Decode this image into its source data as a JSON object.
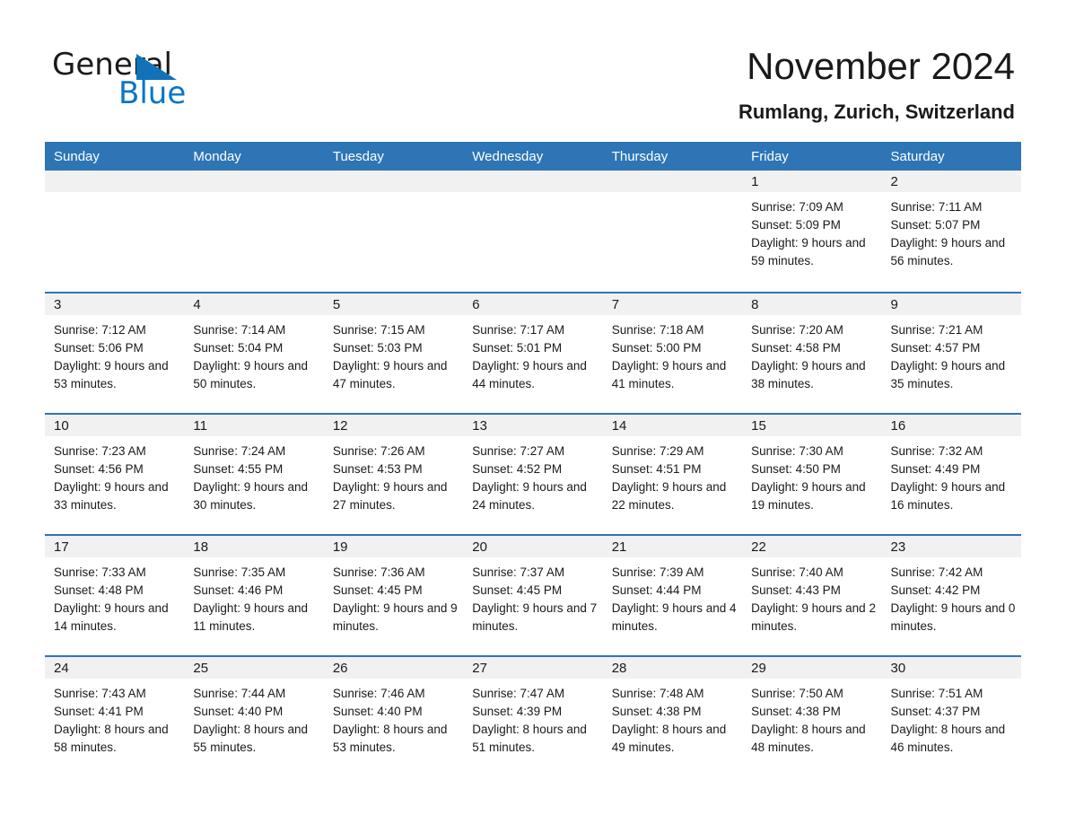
{
  "brand": {
    "name_part1": "General",
    "name_part2": "Blue",
    "triangle_color": "#1272b8",
    "blue_color": "#0a76c4"
  },
  "header": {
    "title": "November 2024",
    "location": "Rumlang, Zurich, Switzerland"
  },
  "theme": {
    "header_blue": "#2e75b6",
    "row_divider_blue": "#2e75b6",
    "daynum_band": "#f1f1f1",
    "text": "#1a1a1a",
    "page_background": "#ffffff"
  },
  "weekday_headers": [
    "Sunday",
    "Monday",
    "Tuesday",
    "Wednesday",
    "Thursday",
    "Friday",
    "Saturday"
  ],
  "labels": {
    "sunrise_prefix": "Sunrise:",
    "sunset_prefix": "Sunset:",
    "daylight_prefix": "Daylight:"
  },
  "weeks": [
    [
      {
        "day": "",
        "empty": true
      },
      {
        "day": "",
        "empty": true
      },
      {
        "day": "",
        "empty": true
      },
      {
        "day": "",
        "empty": true
      },
      {
        "day": "",
        "empty": true
      },
      {
        "day": "1",
        "sunrise": "Sunrise: 7:09 AM",
        "sunset": "Sunset: 5:09 PM",
        "daylight": "Daylight: 9 hours and 59 minutes."
      },
      {
        "day": "2",
        "sunrise": "Sunrise: 7:11 AM",
        "sunset": "Sunset: 5:07 PM",
        "daylight": "Daylight: 9 hours and 56 minutes."
      }
    ],
    [
      {
        "day": "3",
        "sunrise": "Sunrise: 7:12 AM",
        "sunset": "Sunset: 5:06 PM",
        "daylight": "Daylight: 9 hours and 53 minutes."
      },
      {
        "day": "4",
        "sunrise": "Sunrise: 7:14 AM",
        "sunset": "Sunset: 5:04 PM",
        "daylight": "Daylight: 9 hours and 50 minutes."
      },
      {
        "day": "5",
        "sunrise": "Sunrise: 7:15 AM",
        "sunset": "Sunset: 5:03 PM",
        "daylight": "Daylight: 9 hours and 47 minutes."
      },
      {
        "day": "6",
        "sunrise": "Sunrise: 7:17 AM",
        "sunset": "Sunset: 5:01 PM",
        "daylight": "Daylight: 9 hours and 44 minutes."
      },
      {
        "day": "7",
        "sunrise": "Sunrise: 7:18 AM",
        "sunset": "Sunset: 5:00 PM",
        "daylight": "Daylight: 9 hours and 41 minutes."
      },
      {
        "day": "8",
        "sunrise": "Sunrise: 7:20 AM",
        "sunset": "Sunset: 4:58 PM",
        "daylight": "Daylight: 9 hours and 38 minutes."
      },
      {
        "day": "9",
        "sunrise": "Sunrise: 7:21 AM",
        "sunset": "Sunset: 4:57 PM",
        "daylight": "Daylight: 9 hours and 35 minutes."
      }
    ],
    [
      {
        "day": "10",
        "sunrise": "Sunrise: 7:23 AM",
        "sunset": "Sunset: 4:56 PM",
        "daylight": "Daylight: 9 hours and 33 minutes."
      },
      {
        "day": "11",
        "sunrise": "Sunrise: 7:24 AM",
        "sunset": "Sunset: 4:55 PM",
        "daylight": "Daylight: 9 hours and 30 minutes."
      },
      {
        "day": "12",
        "sunrise": "Sunrise: 7:26 AM",
        "sunset": "Sunset: 4:53 PM",
        "daylight": "Daylight: 9 hours and 27 minutes."
      },
      {
        "day": "13",
        "sunrise": "Sunrise: 7:27 AM",
        "sunset": "Sunset: 4:52 PM",
        "daylight": "Daylight: 9 hours and 24 minutes."
      },
      {
        "day": "14",
        "sunrise": "Sunrise: 7:29 AM",
        "sunset": "Sunset: 4:51 PM",
        "daylight": "Daylight: 9 hours and 22 minutes."
      },
      {
        "day": "15",
        "sunrise": "Sunrise: 7:30 AM",
        "sunset": "Sunset: 4:50 PM",
        "daylight": "Daylight: 9 hours and 19 minutes."
      },
      {
        "day": "16",
        "sunrise": "Sunrise: 7:32 AM",
        "sunset": "Sunset: 4:49 PM",
        "daylight": "Daylight: 9 hours and 16 minutes."
      }
    ],
    [
      {
        "day": "17",
        "sunrise": "Sunrise: 7:33 AM",
        "sunset": "Sunset: 4:48 PM",
        "daylight": "Daylight: 9 hours and 14 minutes."
      },
      {
        "day": "18",
        "sunrise": "Sunrise: 7:35 AM",
        "sunset": "Sunset: 4:46 PM",
        "daylight": "Daylight: 9 hours and 11 minutes."
      },
      {
        "day": "19",
        "sunrise": "Sunrise: 7:36 AM",
        "sunset": "Sunset: 4:45 PM",
        "daylight": "Daylight: 9 hours and 9 minutes."
      },
      {
        "day": "20",
        "sunrise": "Sunrise: 7:37 AM",
        "sunset": "Sunset: 4:45 PM",
        "daylight": "Daylight: 9 hours and 7 minutes."
      },
      {
        "day": "21",
        "sunrise": "Sunrise: 7:39 AM",
        "sunset": "Sunset: 4:44 PM",
        "daylight": "Daylight: 9 hours and 4 minutes."
      },
      {
        "day": "22",
        "sunrise": "Sunrise: 7:40 AM",
        "sunset": "Sunset: 4:43 PM",
        "daylight": "Daylight: 9 hours and 2 minutes."
      },
      {
        "day": "23",
        "sunrise": "Sunrise: 7:42 AM",
        "sunset": "Sunset: 4:42 PM",
        "daylight": "Daylight: 9 hours and 0 minutes."
      }
    ],
    [
      {
        "day": "24",
        "sunrise": "Sunrise: 7:43 AM",
        "sunset": "Sunset: 4:41 PM",
        "daylight": "Daylight: 8 hours and 58 minutes."
      },
      {
        "day": "25",
        "sunrise": "Sunrise: 7:44 AM",
        "sunset": "Sunset: 4:40 PM",
        "daylight": "Daylight: 8 hours and 55 minutes."
      },
      {
        "day": "26",
        "sunrise": "Sunrise: 7:46 AM",
        "sunset": "Sunset: 4:40 PM",
        "daylight": "Daylight: 8 hours and 53 minutes."
      },
      {
        "day": "27",
        "sunrise": "Sunrise: 7:47 AM",
        "sunset": "Sunset: 4:39 PM",
        "daylight": "Daylight: 8 hours and 51 minutes."
      },
      {
        "day": "28",
        "sunrise": "Sunrise: 7:48 AM",
        "sunset": "Sunset: 4:38 PM",
        "daylight": "Daylight: 8 hours and 49 minutes."
      },
      {
        "day": "29",
        "sunrise": "Sunrise: 7:50 AM",
        "sunset": "Sunset: 4:38 PM",
        "daylight": "Daylight: 8 hours and 48 minutes."
      },
      {
        "day": "30",
        "sunrise": "Sunrise: 7:51 AM",
        "sunset": "Sunset: 4:37 PM",
        "daylight": "Daylight: 8 hours and 46 minutes."
      }
    ]
  ]
}
